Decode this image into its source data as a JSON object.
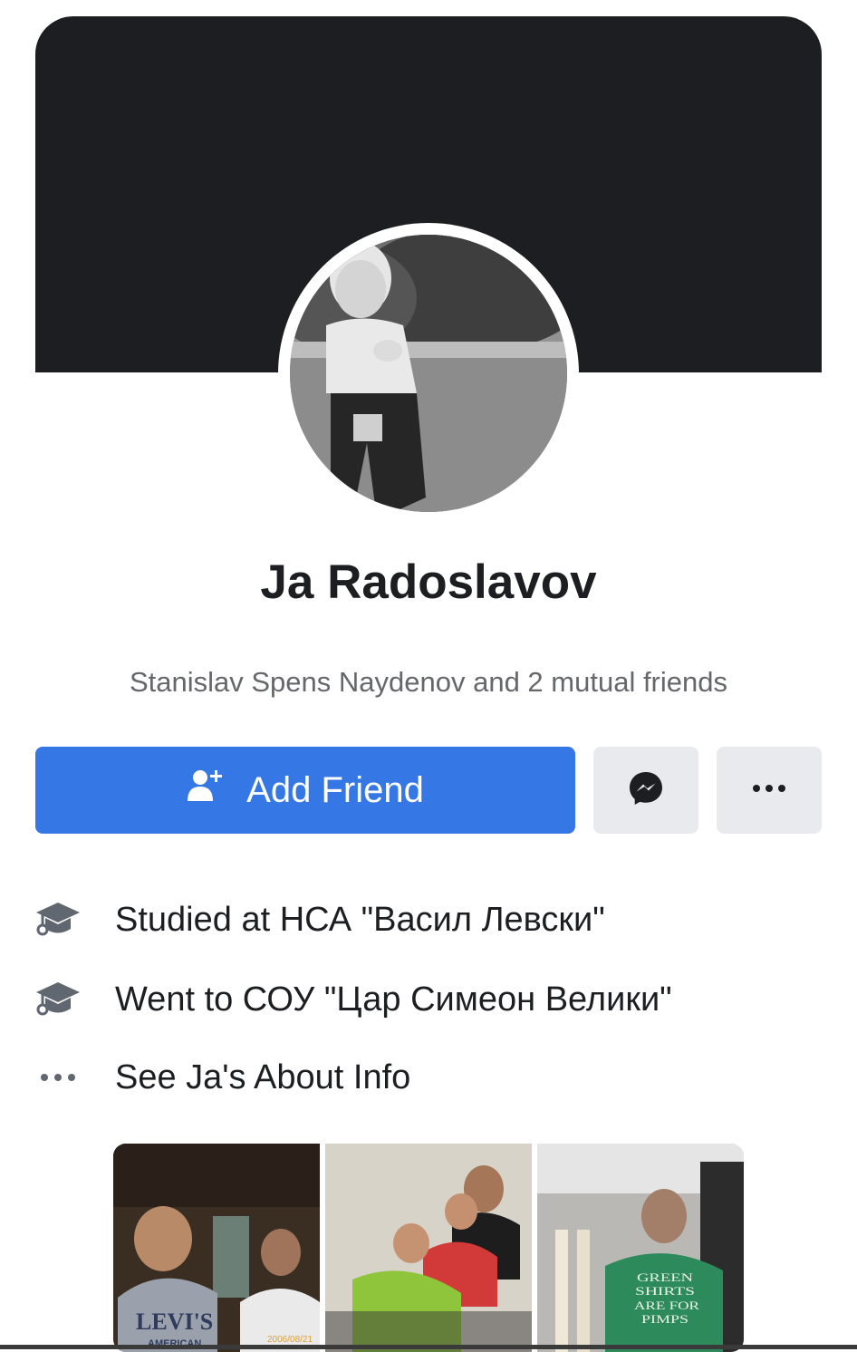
{
  "profile": {
    "name": "Ja Radoslavov",
    "mutual_friends": "Stanislav Spens Naydenov and 2 mutual friends"
  },
  "actions": {
    "add_friend_label": "Add Friend",
    "add_friend_icon": "add-friend-icon",
    "message_icon": "messenger-icon",
    "more_icon": "more-icon"
  },
  "info": [
    {
      "icon": "education-icon",
      "text": "Studied at НСА \"Васил Левски\""
    },
    {
      "icon": "education-icon",
      "text": "Went to СОУ \"Цар Симеон Велики\""
    },
    {
      "icon": "more-icon",
      "text": "See Ja's About Info"
    }
  ],
  "photos": {
    "photo_1": {
      "shirt_text": "LEVI'S",
      "shirt_subtext": "AMERICAN",
      "date_stamp": "2006/08/21"
    },
    "photo_3": {
      "shirt_text": "GREEN SHIRTS ARE FOR PIMPS"
    }
  },
  "colors": {
    "primary": "#3578e5",
    "cover": "#1c1e21",
    "secondary_text": "#65676b",
    "gray_button": "#e9eaee"
  }
}
